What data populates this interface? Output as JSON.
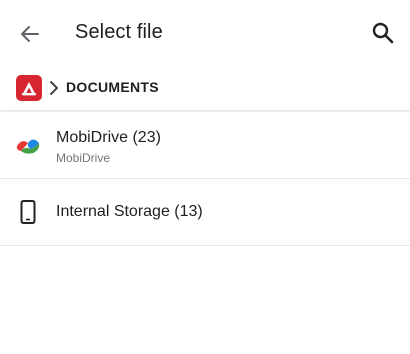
{
  "appbar": {
    "title": "Select file",
    "back_icon": "arrow-left-icon",
    "search_icon": "search-icon"
  },
  "breadcrumb": {
    "app_logo_icon": "mobidrive-red-logo-icon",
    "separator_icon": "chevron-right-icon",
    "current": "DOCUMENTS"
  },
  "locations": [
    {
      "name": "MobiDrive (23)",
      "subtitle": "MobiDrive",
      "icon": "mobidrive-cloud-icon"
    },
    {
      "name": "Internal Storage (13)",
      "icon": "phone-icon"
    }
  ],
  "colors": {
    "brand_red": "#d7262f",
    "divider": "#e8e8e8",
    "secondary_text": "#757575"
  }
}
